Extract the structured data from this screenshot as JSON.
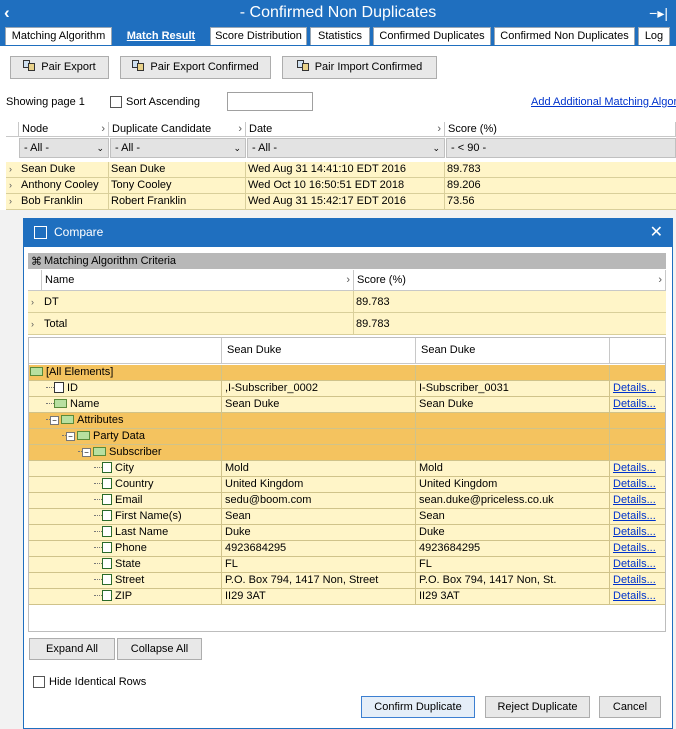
{
  "window": {
    "title": "- Confirmed Non Duplicates",
    "back_icon": "chevron-left-icon",
    "pin_icon": "pin-icon"
  },
  "tabs": [
    {
      "label": "Matching Algorithm",
      "active": false
    },
    {
      "label": "Match Result",
      "active": true
    },
    {
      "label": "Score Distribution",
      "active": false
    },
    {
      "label": "Statistics",
      "active": false
    },
    {
      "label": "Confirmed Duplicates",
      "active": false
    },
    {
      "label": "Confirmed Non Duplicates",
      "active": false
    },
    {
      "label": "Log",
      "active": false
    }
  ],
  "toolbar": {
    "pair_export": "Pair Export",
    "pair_export_confirmed": "Pair Export Confirmed",
    "pair_import_confirmed": "Pair Import Confirmed"
  },
  "paging": {
    "showing": "Showing page 1",
    "sort_ascending": "Sort Ascending",
    "search_value": "",
    "add_link": "Add Additional Matching Algorithm"
  },
  "grid": {
    "headers": [
      "Node",
      "Duplicate Candidate",
      "Date",
      "Score (%)"
    ],
    "filters": [
      "- All -",
      "- All -",
      "- All -",
      "- < 90 -"
    ],
    "rows": [
      {
        "node": "Sean Duke",
        "candidate": "Sean Duke",
        "date": "Wed Aug 31 14:41:10 EDT 2016",
        "score": "89.783"
      },
      {
        "node": "Anthony Cooley",
        "candidate": "Tony Cooley",
        "date": "Wed Oct 10 16:50:51 EDT 2018",
        "score": "89.206"
      },
      {
        "node": "Bob Franklin",
        "candidate": "Robert Franklin",
        "date": "Wed Aug 31 15:42:17 EDT 2016",
        "score": "73.56"
      }
    ]
  },
  "dialog": {
    "title": "Compare",
    "criteria_title": "Matching Algorithm Criteria",
    "criteria_headers": [
      "Name",
      "Score (%)"
    ],
    "criteria_rows": [
      {
        "name": "DT",
        "score": "89.783"
      },
      {
        "name": "Total",
        "score": "89.783"
      }
    ],
    "compare_headers": [
      "Sean Duke",
      "Sean Duke"
    ],
    "details_label": "Details...",
    "tree": [
      {
        "label": "[All Elements]",
        "a": "",
        "b": "",
        "type": "group",
        "indent": 0,
        "details": false
      },
      {
        "label": "ID",
        "a": ",I-Subscriber_0002",
        "b": "I-Subscriber_0031",
        "type": "leaf-id",
        "indent": 1,
        "details": true
      },
      {
        "label": "Name",
        "a": "Sean Duke",
        "b": "Sean Duke",
        "type": "leaf-name",
        "indent": 1,
        "details": true
      },
      {
        "label": "Attributes",
        "a": "",
        "b": "",
        "type": "group",
        "indent": 1,
        "details": false
      },
      {
        "label": "Party Data",
        "a": "",
        "b": "",
        "type": "group",
        "indent": 2,
        "details": false
      },
      {
        "label": "Subscriber",
        "a": "",
        "b": "",
        "type": "group",
        "indent": 3,
        "details": false
      },
      {
        "label": "City",
        "a": "Mold",
        "b": "Mold",
        "type": "leaf",
        "indent": 4,
        "details": true
      },
      {
        "label": "Country",
        "a": "United Kingdom",
        "b": "United Kingdom",
        "type": "leaf",
        "indent": 4,
        "details": true
      },
      {
        "label": "Email",
        "a": "sedu@boom.com",
        "b": "sean.duke@priceless.co.uk",
        "type": "leaf",
        "indent": 4,
        "details": true
      },
      {
        "label": "First Name(s)",
        "a": "Sean",
        "b": "Sean",
        "type": "leaf",
        "indent": 4,
        "details": true
      },
      {
        "label": "Last Name",
        "a": "Duke",
        "b": "Duke",
        "type": "leaf",
        "indent": 4,
        "details": true
      },
      {
        "label": "Phone",
        "a": "4923684295",
        "b": "4923684295",
        "type": "leaf",
        "indent": 4,
        "details": true
      },
      {
        "label": "State",
        "a": "FL",
        "b": "FL",
        "type": "leaf",
        "indent": 4,
        "details": true
      },
      {
        "label": "Street",
        "a": "P.O. Box 794, 1417 Non, Street",
        "b": "P.O. Box 794, 1417 Non, St.",
        "type": "leaf",
        "indent": 4,
        "details": true
      },
      {
        "label": "ZIP",
        "a": "II29 3AT",
        "b": "II29 3AT",
        "type": "leaf",
        "indent": 4,
        "details": true
      }
    ],
    "expand_all": "Expand All",
    "collapse_all": "Collapse All",
    "hide_identical": "Hide Identical Rows",
    "confirm": "Confirm Duplicate",
    "reject": "Reject Duplicate",
    "cancel": "Cancel"
  },
  "colors": {
    "accent": "#1f6fbf",
    "row_bg": "#fff5c8",
    "group_bg": "#f4c35f",
    "link": "#0033cc"
  }
}
